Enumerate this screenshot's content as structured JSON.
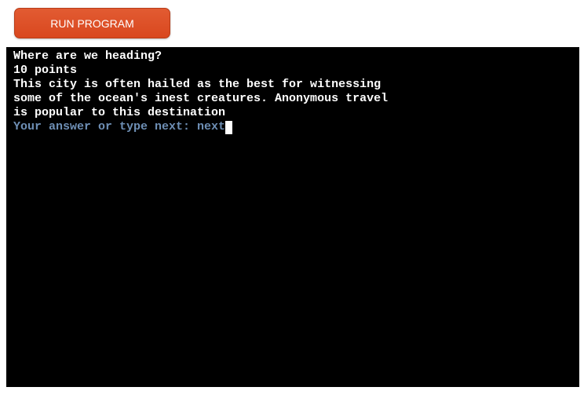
{
  "toolbar": {
    "run_label": "RUN PROGRAM"
  },
  "terminal": {
    "lines": [
      "Where are we heading?",
      "10 points",
      "This city is often hailed as the best for witnessing",
      "some of the ocean's inest creatures. Anonymous travel",
      "is popular to this destination"
    ],
    "prompt": "Your answer or type next: ",
    "input_value": "next"
  },
  "colors": {
    "button": "#d9481f",
    "terminal_bg": "#000000",
    "terminal_text": "#ffffff",
    "prompt_text": "#6e8fb5"
  }
}
